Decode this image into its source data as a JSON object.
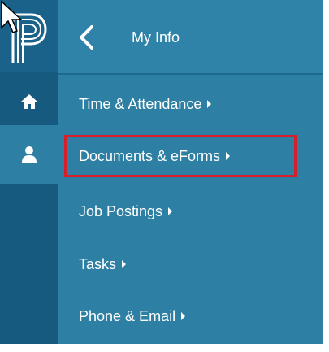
{
  "header": {
    "back_label": "",
    "title": "My Info"
  },
  "rail": {
    "logo_icon": "powerschool-p-logo",
    "items": [
      {
        "icon": "home-icon"
      },
      {
        "icon": "user-icon",
        "active": true
      }
    ]
  },
  "menu": {
    "items": [
      {
        "label": "Time & Attendance"
      },
      {
        "label": "Documents & eForms",
        "highlighted": true
      },
      {
        "label": "Job Postings"
      },
      {
        "label": "Tasks"
      },
      {
        "label": "Phone & Email"
      }
    ]
  },
  "colors": {
    "panel": "#2d7fa3",
    "rail": "#165b7f",
    "highlight_border": "#d5202b",
    "text": "#ffffff"
  }
}
